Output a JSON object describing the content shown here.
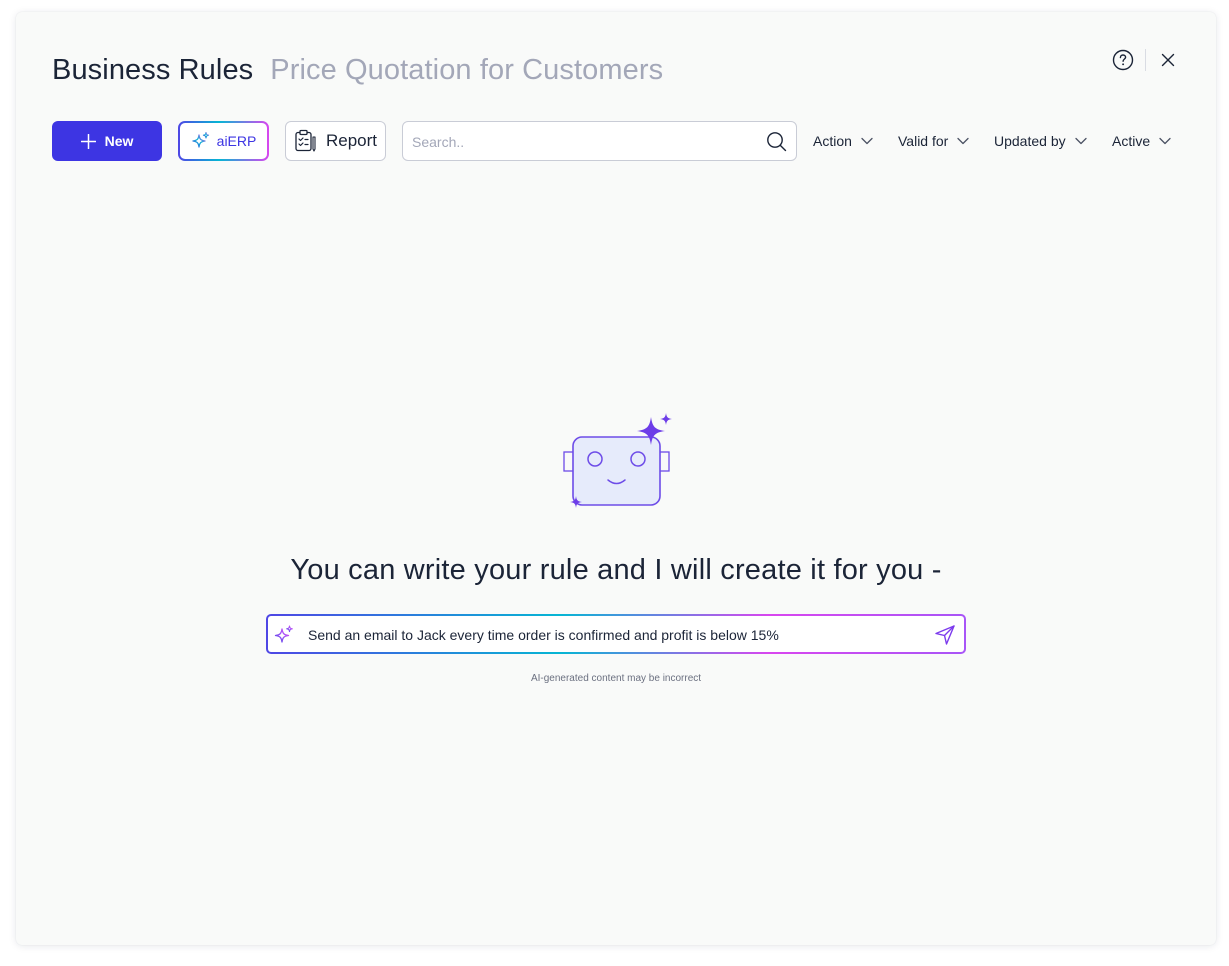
{
  "header": {
    "title": "Business Rules",
    "subtitle": "Price Quotation for Customers",
    "help_icon": "question-circle-icon",
    "close_icon": "close-icon"
  },
  "toolbar": {
    "new_label": "New",
    "ai_label": "aiERP",
    "report_label": "Report",
    "search_placeholder": "Search..",
    "search_value": "",
    "filters": [
      {
        "label": "Action"
      },
      {
        "label": "Valid for"
      },
      {
        "label": "Updated by"
      },
      {
        "label": "Active"
      }
    ]
  },
  "main": {
    "headline": "You can write your rule and I will create it for you -",
    "prompt_value": "Send an email to Jack every time order is confirmed and profit is below 15%",
    "disclaimer": "AI-generated content may be incorrect"
  },
  "colors": {
    "accent": "#3d35e3",
    "robot_stroke": "#6d4ce8",
    "robot_fill": "#e6ebfb",
    "text_primary": "#1b2437",
    "text_muted": "#a3a7b8"
  }
}
